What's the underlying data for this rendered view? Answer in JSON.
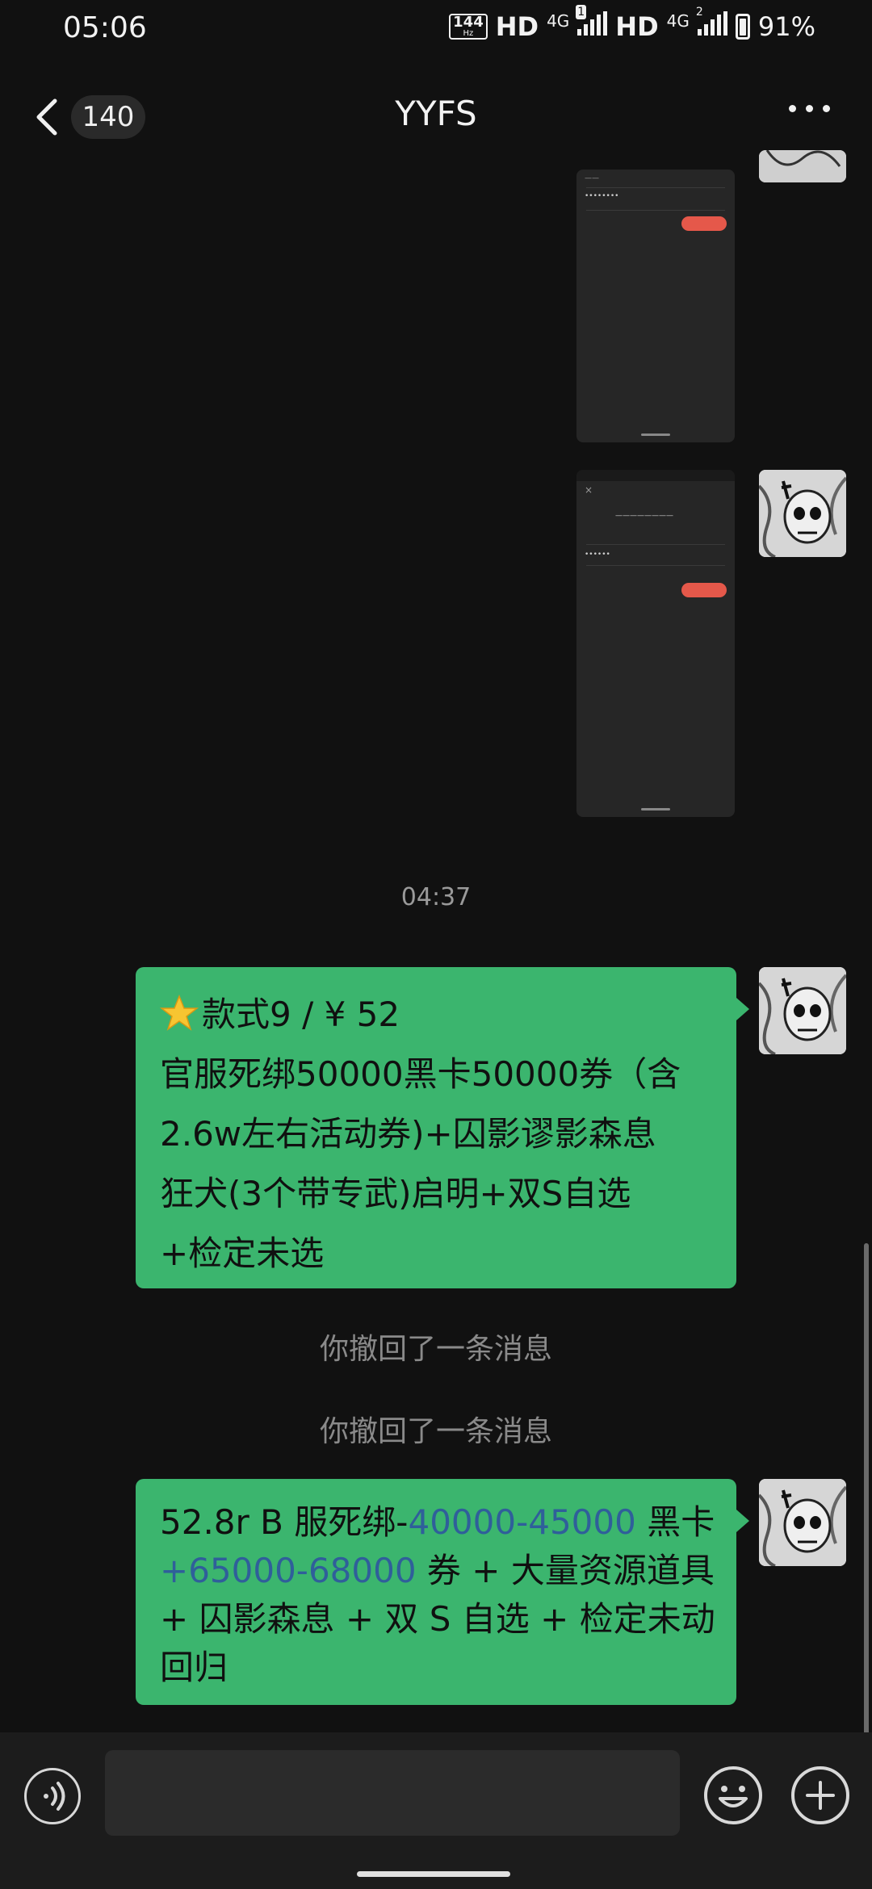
{
  "status_bar": {
    "time": "05:06",
    "refresh_rate": "144",
    "refresh_unit": "Hz",
    "hd1": "HD",
    "net1": "4G",
    "sim1": "1",
    "hd2": "HD",
    "net2": "4G",
    "sim2": "2",
    "battery": "91%"
  },
  "header": {
    "unread_count": "140",
    "title": "YYFS"
  },
  "messages": {
    "timestamp": "04:37",
    "bubble1": {
      "line1": "款式9 / ¥ 52",
      "line2": "官服死绑50000黑卡50000券（含",
      "line3": "2.6w左右活动券)+囚影谬影森息",
      "line4": "狂犬(3个带专武)启明+双S自选",
      "line5": "+检定未选"
    },
    "recall1": "你撤回了一条消息",
    "recall2": "你撤回了一条消息",
    "bubble2": {
      "seg1": "52.8r B 服死绑-",
      "seg2": "40000-45000",
      "seg3": " 黑卡",
      "seg4": "+65000-68000",
      "seg5": " 券 + 大量资源道具",
      "line3": "+ 囚影森息 + 双 S 自选 + 检定未动",
      "line4": "回归"
    }
  },
  "colors": {
    "background": "#111111",
    "bubble_green": "#3bb56e",
    "link_blue": "#2f5f9a"
  },
  "input": {
    "placeholder": ""
  }
}
